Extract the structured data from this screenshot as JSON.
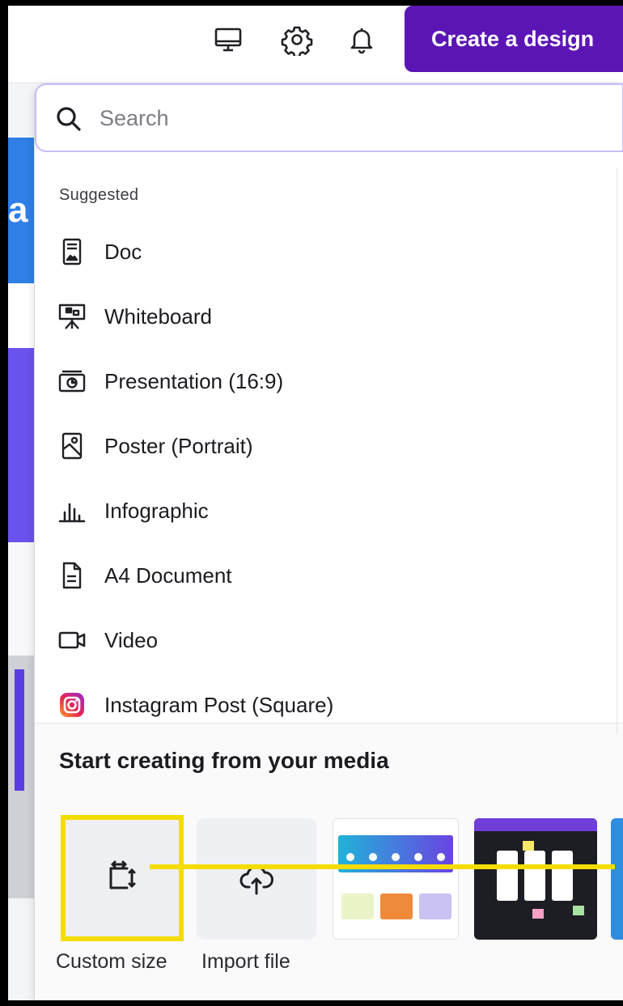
{
  "topbar": {
    "icons": [
      "desktop-icon",
      "gear-icon",
      "bell-icon"
    ],
    "create_label": "Create a design",
    "accent": "#5b15b5"
  },
  "background": {
    "letter": "a"
  },
  "search": {
    "placeholder": "Search"
  },
  "suggested": {
    "label": "Suggested",
    "items": [
      {
        "label": "Doc",
        "icon": "doc-icon"
      },
      {
        "label": "Whiteboard",
        "icon": "whiteboard-icon"
      },
      {
        "label": "Presentation (16:9)",
        "icon": "presentation-icon"
      },
      {
        "label": "Poster (Portrait)",
        "icon": "poster-icon"
      },
      {
        "label": "Infographic",
        "icon": "infographic-icon"
      },
      {
        "label": "A4 Document",
        "icon": "document-icon"
      },
      {
        "label": "Video",
        "icon": "video-icon"
      },
      {
        "label": "Instagram Post (Square)",
        "icon": "instagram-icon"
      }
    ]
  },
  "media": {
    "title": "Start creating from your media",
    "tiles": [
      {
        "label": "Custom size",
        "icon": "custom-size-icon"
      },
      {
        "label": "Import file",
        "icon": "cloud-upload-icon"
      }
    ],
    "highlight_color": "#f5dc00"
  }
}
